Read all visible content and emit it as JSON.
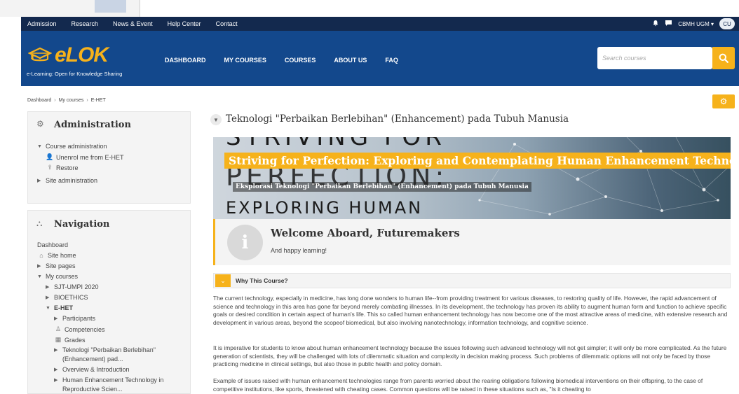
{
  "topbar": {
    "links": [
      "Admission",
      "Research",
      "News & Event",
      "Help Center",
      "Contact"
    ],
    "user_name": "CBMH UGM",
    "avatar_initials": "CU"
  },
  "header": {
    "logo_text": "eLOK",
    "logo_tagline": "e-Learning: Open for Knowledge Sharing",
    "nav": [
      "DASHBOARD",
      "MY COURSES",
      "COURSES",
      "ABOUT US",
      "FAQ"
    ],
    "search_placeholder": "Search courses"
  },
  "breadcrumb": [
    "Dashboard",
    "My courses",
    "E-HET"
  ],
  "administration": {
    "title": "Administration",
    "items": [
      "Course administration",
      "Unenrol me from E-HET",
      "Restore",
      "Site administration"
    ]
  },
  "navigation": {
    "title": "Navigation",
    "items": [
      "Dashboard",
      "Site home",
      "Site pages",
      "My courses",
      "SJT-UMPI 2020",
      "BIOETHICS",
      "E-HET",
      "Participants",
      "Competencies",
      "Grades",
      "Teknologi \"Perbaikan Berlebihan\"",
      "(Enhancement) pad...",
      "Overview & Introduction",
      "Human Enhancement Technology in",
      "Reproductive Scien..."
    ]
  },
  "section": {
    "title": "Teknologi \"Perbaikan Berlebihan\" (Enhancement) pada Tubuh Manusia"
  },
  "banner": {
    "bg_line1": "STRIVING FOR",
    "bg_line2": "PERFECTION:",
    "bg_line3": "EXPLORING HUMAN",
    "title": "Striving for Perfection: Exploring and Contemplating Human Enhancement Technology",
    "subtitle": "Eksplorasi Teknologi \"Perbaikan Berlebihan\" (Enhancement) pada Tubuh Manusia"
  },
  "welcome": {
    "icon": "i",
    "title": "Welcome Aboard, Futuremakers",
    "subtitle": "And happy learning!"
  },
  "why": {
    "label": "Why This Course?"
  },
  "paragraphs": [
    "The current technology, especially in medicine, has long done wonders to human life--from providing treatment for various diseases, to restoring quality of life. However, the rapid advancement of science and technology in this area has gone far beyond merely combating illnesses. In its development, the technology has proven its ability to augment human form and function to achieve specific goals or desired condition in certain aspect of human's life. This so called human enhancement technology has now become one of the most attractive areas of medicine, with extensive research and development in various areas, beyond the scopeof biomedical, but also involving nanotechnology, information technology, and cognitive science.",
    "It is imperative for students to know about human enhancement technology because the issues following such advanced technology will not get simpler; it will only be more complicated. As the future generation of scientists, they will be challenged with lots of dilemmatic situation and complexity in decision making process. Such problems of dilemmatic options will not only be faced by those practicing medicine in clinical settings, but also those in public health and policy domain.",
    "Example of issues raised with human enhancement technologies range from parents worried about the rearing obligations following biomedical interventions on their offspring, to the case of competitive institutions, like sports, threatened with cheating cases. Common questions will be raised in these situations such as, \"Is it cheating to"
  ],
  "colors": {
    "topbar_bg": "#13294e",
    "header_bg": "#13488c",
    "accent": "#f6b21b"
  }
}
